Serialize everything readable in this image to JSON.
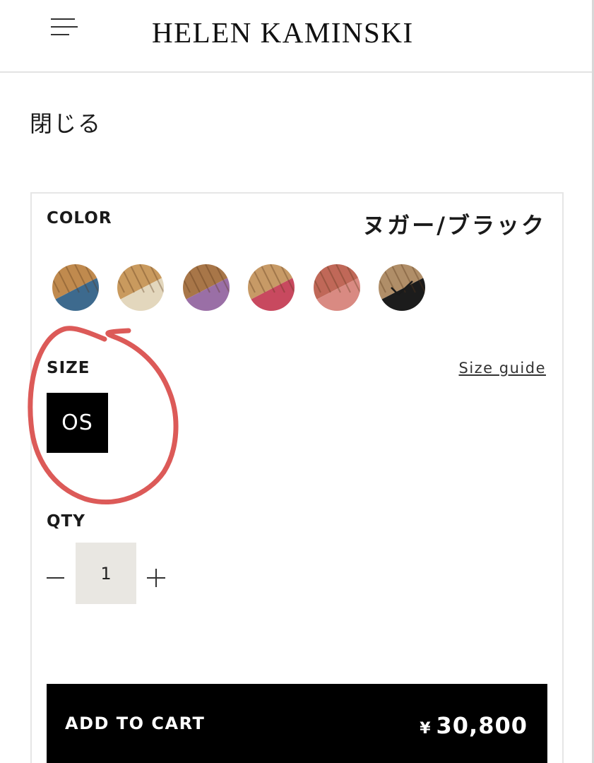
{
  "header": {
    "menu_icon": "hamburger-menu-icon",
    "logo": "HELEN KAMINSKI"
  },
  "close_label": "閉じる",
  "color": {
    "label": "COLOR",
    "selected_name": "ヌガー/ブラック",
    "swatches": [
      {
        "icon": "swatch-raffia-blue",
        "top": "#c08a4e",
        "bottom": "#3d6a8e",
        "selected": false
      },
      {
        "icon": "swatch-raffia-cream",
        "top": "#c99a5e",
        "bottom": "#e3d7bd",
        "selected": false
      },
      {
        "icon": "swatch-raffia-purple",
        "top": "#a87648",
        "bottom": "#9a6fa6",
        "selected": false
      },
      {
        "icon": "swatch-raffia-raspberry",
        "top": "#c79a66",
        "bottom": "#c8495f",
        "selected": false
      },
      {
        "icon": "swatch-raffia-coral",
        "top": "#c06858",
        "bottom": "#d98a82",
        "selected": false
      },
      {
        "icon": "swatch-nougat-black",
        "top": "#b08e68",
        "bottom": "#1c1c1c",
        "selected": true
      }
    ]
  },
  "size": {
    "label": "SIZE",
    "guide_link": "Size guide",
    "options": [
      "OS"
    ],
    "selected": "OS"
  },
  "qty": {
    "label": "QTY",
    "value": "1",
    "minus_icon": "minus-icon",
    "plus_icon": "plus-icon"
  },
  "cart": {
    "label": "ADD TO CART",
    "currency": "¥",
    "price": "30,800"
  },
  "colors": {
    "annotation": "#dc5a58",
    "cart_background": "#000000",
    "qty_background": "#e9e7e2"
  }
}
